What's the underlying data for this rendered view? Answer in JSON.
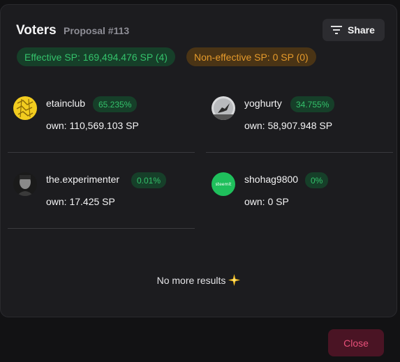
{
  "header": {
    "title": "Voters",
    "subtitle": "Proposal #113"
  },
  "share_button": {
    "label": "Share",
    "icon": "filter-icon"
  },
  "summary": {
    "effective": "Effective SP: 169,494.476 SP (4)",
    "non_effective": "Non-effective SP: 0 SP (0)"
  },
  "voters": [
    {
      "name": "etainclub",
      "percent": "65.235%",
      "own": "own: 110,569.103 SP"
    },
    {
      "name": "yoghurty",
      "percent": "34.755%",
      "own": "own: 58,907.948 SP"
    },
    {
      "name": "the.experimenter",
      "percent": "0.01%",
      "own": "own: 17.425 SP"
    },
    {
      "name": "shohag9800",
      "percent": "0%",
      "own": "own: 0 SP",
      "avatar_text": "steemit"
    }
  ],
  "footer": {
    "no_more": "No more results",
    "close_label": "Close"
  },
  "colors": {
    "effective_green": "#34c26b",
    "non_effective_orange": "#e59a2b",
    "close_pink": "#e8507a"
  }
}
